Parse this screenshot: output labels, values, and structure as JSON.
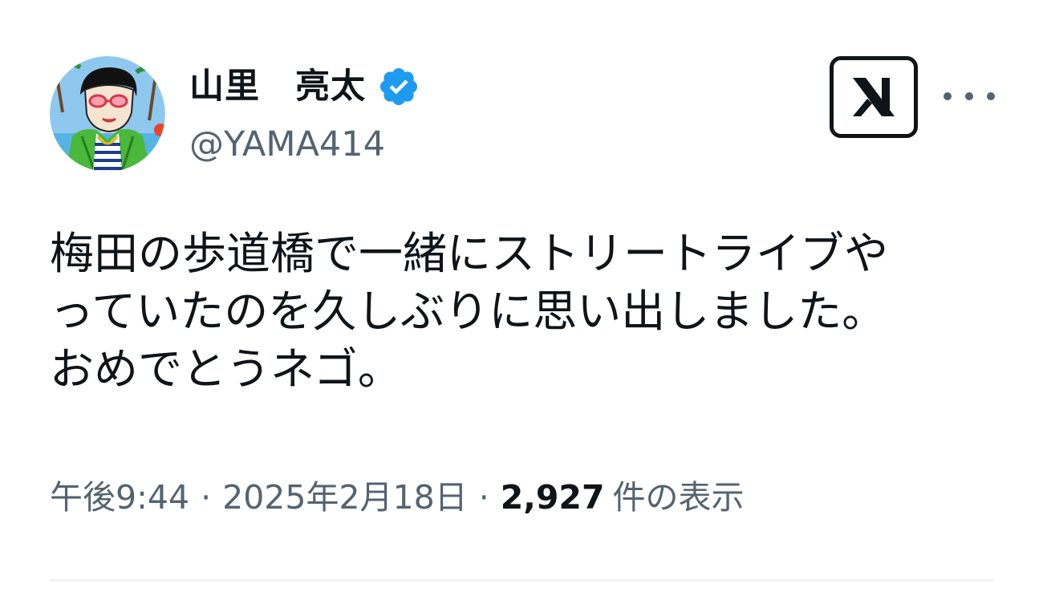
{
  "user": {
    "display_name": "山里　亮太",
    "handle": "@YAMA414",
    "verified_icon": "verified-badge-icon",
    "avatar_icon": "avatar-illustration"
  },
  "actions": {
    "logo_icon": "x-logo-icon",
    "more_icon": "more-options-icon"
  },
  "tweet": {
    "lines": [
      "梅田の歩道橋で一緒にストリートライブや",
      "っていたのを久しぶりに思い出しました。",
      "おめでとうネゴ。"
    ]
  },
  "meta": {
    "time": "午後9:44",
    "separator": "·",
    "date": "2025年2月18日",
    "view_count": "2,927",
    "view_label": "件の表示"
  },
  "colors": {
    "text_primary": "#0f1419",
    "text_secondary": "#536471",
    "verified_blue": "#1d9bf0",
    "divider": "#eff3f4"
  }
}
